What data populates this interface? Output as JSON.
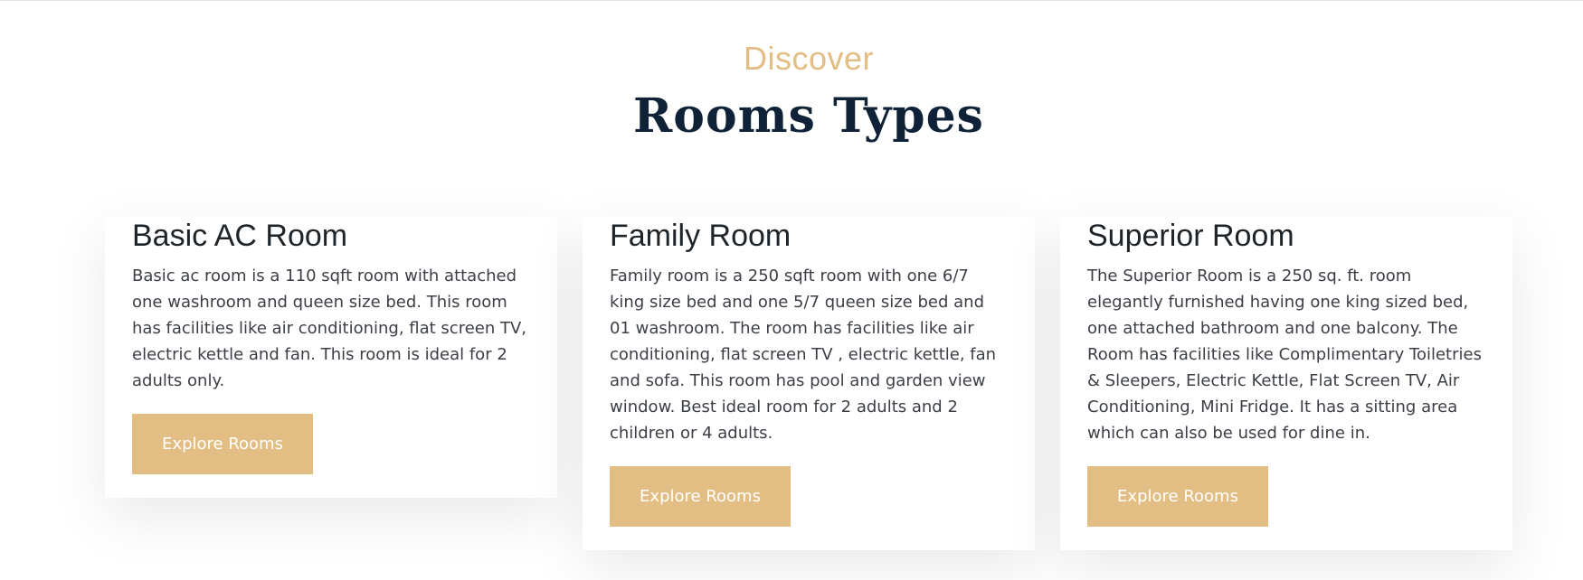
{
  "header": {
    "eyebrow": "Discover",
    "title": "Rooms Types"
  },
  "colors": {
    "accent": "#e2bd84",
    "heading": "#0f2238",
    "text": "#3b3f45"
  },
  "rooms": [
    {
      "name": "Basic AC Room",
      "description": "Basic ac room is a 110 sqft room with attached one washroom and queen size bed. This room has facilities like air conditioning, flat screen TV, electric kettle and fan. This room is ideal for 2 adults only.",
      "button_label": "Explore Rooms"
    },
    {
      "name": "Family Room",
      "description": "Family room is a 250 sqft room with one 6/7 king size bed and one 5/7 queen size bed and 01 washroom. The room has facilities like air conditioning, flat screen TV , electric kettle, fan and sofa. This room has pool and garden view window. Best ideal room for 2 adults and 2 children or 4 adults.",
      "button_label": "Explore Rooms"
    },
    {
      "name": "Superior Room",
      "description": "The Superior Room is a 250 sq. ft. room elegantly furnished having one king sized bed, one attached bathroom and one balcony. The Room has facilities like Complimentary Toiletries & Sleepers, Electric Kettle, Flat Screen TV, Air Conditioning, Mini Fridge. It has a sitting area which can also be used for dine in.",
      "button_label": "Explore Rooms"
    }
  ]
}
